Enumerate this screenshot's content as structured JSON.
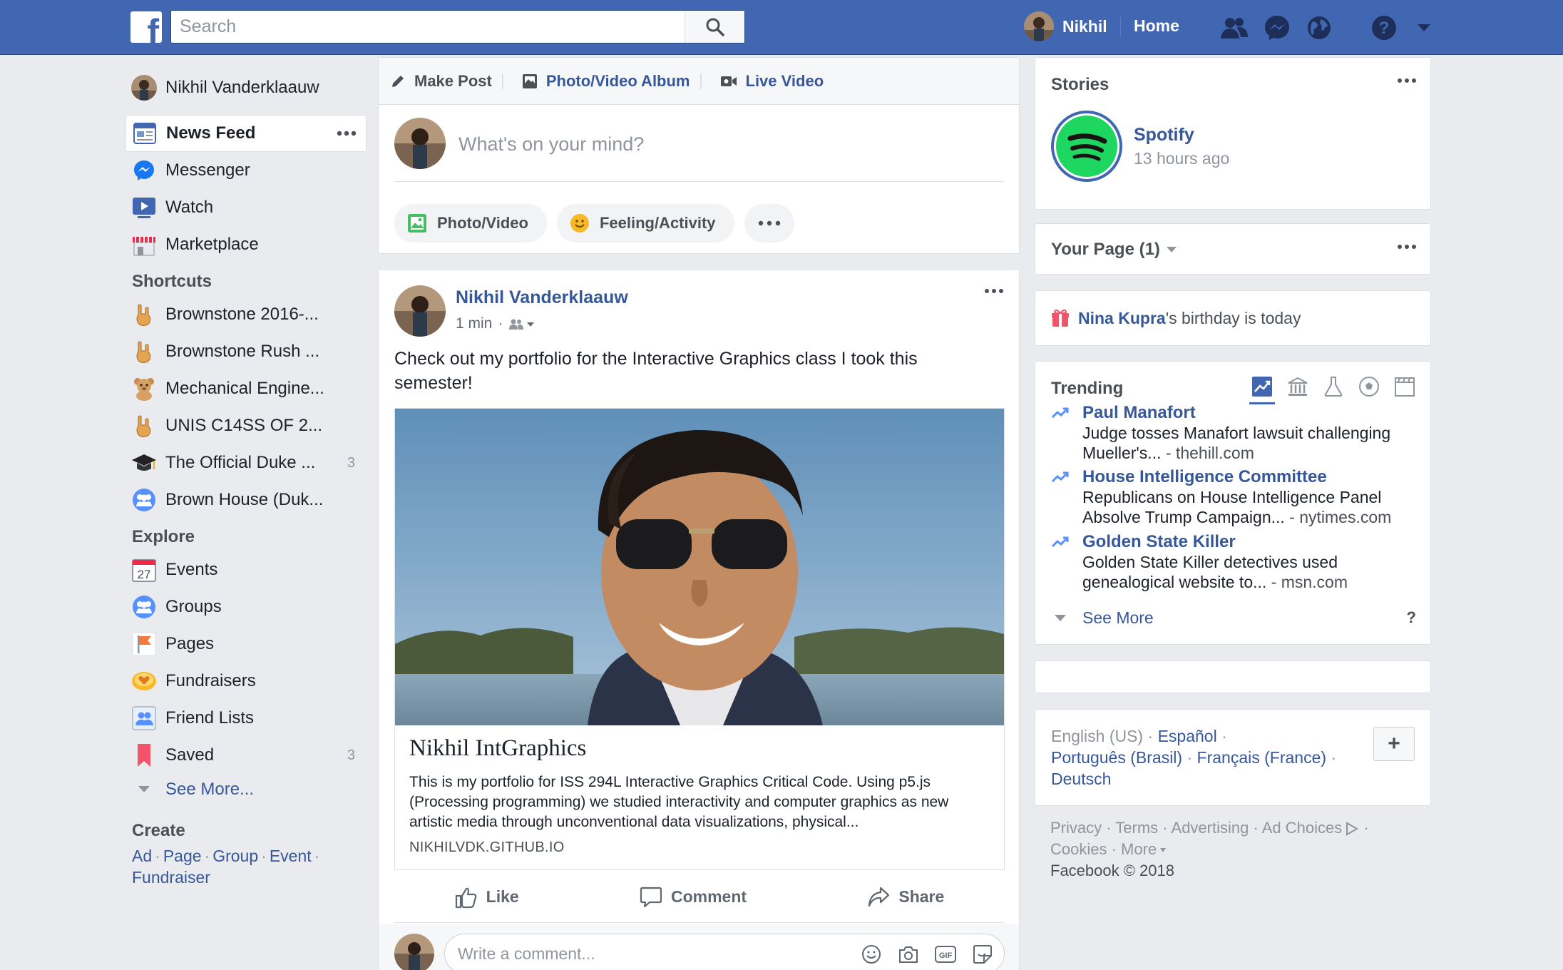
{
  "topbar": {
    "logo_letter": "f",
    "search_placeholder": "Search",
    "user_name": "Nikhil",
    "home_label": "Home",
    "icons": [
      "friends-icon",
      "messenger-icon",
      "globe-icon",
      "help-icon",
      "caret-down-icon"
    ],
    "colors": {
      "bar": "#4267b2",
      "link": "#365899"
    }
  },
  "sidebar": {
    "profile_name": "Nikhil Vanderklaauw",
    "main_items": [
      {
        "label": "News Feed",
        "icon": "news-feed-icon"
      },
      {
        "label": "Messenger",
        "icon": "messenger-icon"
      },
      {
        "label": "Watch",
        "icon": "watch-icon"
      },
      {
        "label": "Marketplace",
        "icon": "marketplace-icon"
      }
    ],
    "shortcuts_title": "Shortcuts",
    "shortcuts": [
      {
        "label": "Brownstone 2016-...",
        "icon": "rock-hand-icon",
        "count": ""
      },
      {
        "label": "Brownstone Rush ...",
        "icon": "rock-hand-icon",
        "count": ""
      },
      {
        "label": "Mechanical Engine...",
        "icon": "teddy-bear-icon",
        "count": ""
      },
      {
        "label": "UNIS C14SS OF 2...",
        "icon": "rock-hand-icon",
        "count": ""
      },
      {
        "label": "The Official Duke ...",
        "icon": "graduation-cap-icon",
        "count": "3"
      },
      {
        "label": "Brown House (Duk...",
        "icon": "group-icon",
        "count": ""
      }
    ],
    "explore_title": "Explore",
    "explore": [
      {
        "label": "Events",
        "icon": "calendar-icon",
        "count": "",
        "calendar_day": "27"
      },
      {
        "label": "Groups",
        "icon": "groups-icon",
        "count": ""
      },
      {
        "label": "Pages",
        "icon": "flag-icon",
        "count": ""
      },
      {
        "label": "Fundraisers",
        "icon": "heart-coin-icon",
        "count": ""
      },
      {
        "label": "Friend Lists",
        "icon": "friend-list-icon",
        "count": ""
      },
      {
        "label": "Saved",
        "icon": "bookmark-icon",
        "count": "3"
      }
    ],
    "see_more": "See More...",
    "create_title": "Create",
    "create_links": [
      "Ad",
      "Page",
      "Group",
      "Event",
      "Fundraiser"
    ]
  },
  "composer": {
    "tabs": [
      "Make Post",
      "Photo/Video Album",
      "Live Video"
    ],
    "placeholder": "What's on your mind?",
    "buttons": [
      "Photo/Video",
      "Feeling/Activity"
    ]
  },
  "post": {
    "author": "Nikhil Vanderklaauw",
    "time": "1 min",
    "text": "Check out my portfolio for the Interactive Graphics class I took this semester!",
    "link_title": "Nikhil IntGraphics",
    "link_description": "This is my portfolio for ISS 294L Interactive Graphics Critical Code. Using p5.js (Processing programming) we studied interactivity and computer graphics as new artistic media through unconventional data visualizations, physical...",
    "link_url": "NIKHILVDK.GITHUB.IO",
    "actions": [
      "Like",
      "Comment",
      "Share"
    ],
    "comment_placeholder": "Write a comment..."
  },
  "right": {
    "stories_title": "Stories",
    "story": {
      "name": "Spotify",
      "time": "13 hours ago"
    },
    "your_page": "Your Page (1)",
    "birthday_name": "Nina Kupra",
    "birthday_suffix": "'s birthday is today",
    "trending_title": "Trending",
    "trending": [
      {
        "title": "Paul Manafort",
        "desc": "Judge tosses Manafort lawsuit challenging Mueller's...",
        "source": " - thehill.com"
      },
      {
        "title": "House Intelligence Committee",
        "desc": "Republicans on House Intelligence Panel Absolve Trump Campaign...",
        "source": " - nytimes.com"
      },
      {
        "title": "Golden State Killer",
        "desc": "Golden State Killer detectives used genealogical website to...",
        "source": " - msn.com"
      }
    ],
    "see_more": "See More",
    "help": "?",
    "languages": {
      "current": "English (US)",
      "others": [
        "Español",
        "Português (Brasil)",
        "Français (France)",
        "Deutsch"
      ]
    },
    "add_language": "+",
    "footer_links": [
      "Privacy",
      "Terms",
      "Advertising",
      "Ad Choices",
      "Cookies",
      "More"
    ],
    "copyright": "Facebook © 2018"
  }
}
